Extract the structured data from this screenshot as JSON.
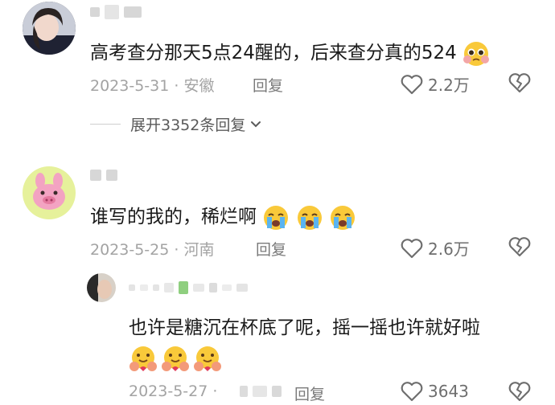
{
  "comments": [
    {
      "text": "高考查分那天5点24醒的，后来查分真的524",
      "date_location": "2023-5-31 · 安徽",
      "reply_label": "回复",
      "likes": "2.2万",
      "expand_label": "展开3352条回复",
      "emoji": "pleading-face"
    },
    {
      "text": "谁写的我的，稀烂啊",
      "date_location": "2023-5-25 · 河南",
      "reply_label": "回复",
      "likes": "2.6万",
      "emoji": "loudly-crying-face"
    }
  ],
  "reply": {
    "text": "也许是糖沉在杯底了呢，摇一摇也许就好啦",
    "date": "2023-5-27 ·",
    "reply_label": "回复",
    "likes": "3643",
    "emoji": "hugging-face"
  },
  "colors": {
    "text": "#1a1a1a",
    "meta": "#a3a3a3",
    "avatar2_bg": "#e6f19b",
    "avatar2_pig": "#f3a3c2"
  }
}
